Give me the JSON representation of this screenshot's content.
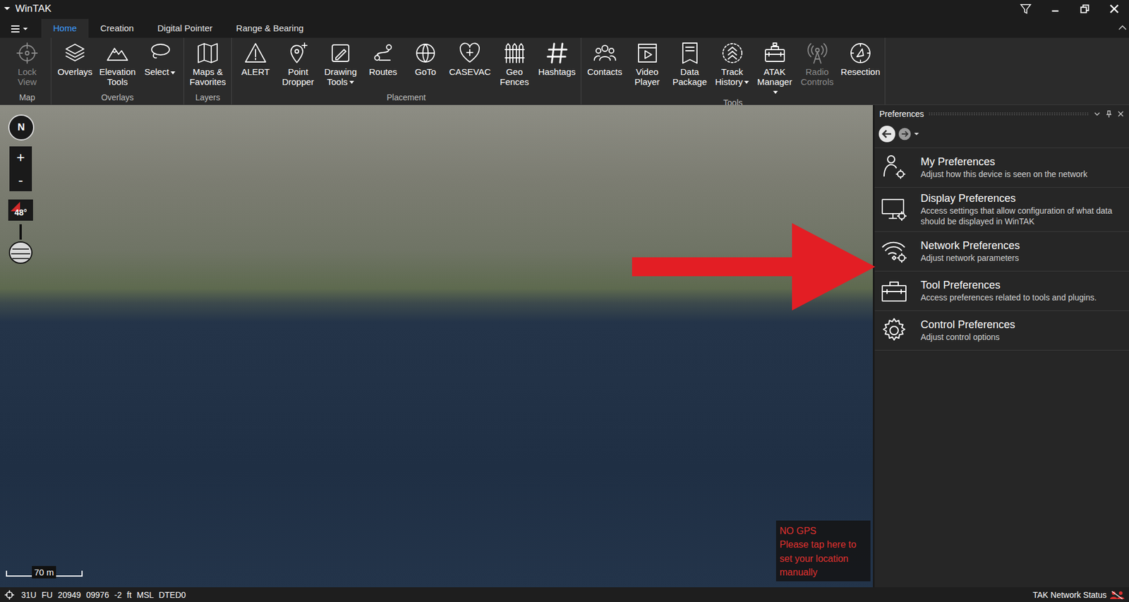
{
  "window": {
    "title": "WinTAK"
  },
  "tabs": [
    {
      "label": "Home",
      "selected": true
    },
    {
      "label": "Creation",
      "selected": false
    },
    {
      "label": "Digital Pointer",
      "selected": false
    },
    {
      "label": "Range & Bearing",
      "selected": false
    }
  ],
  "ribbon_groups": [
    {
      "label": "Map",
      "buttons": [
        {
          "label": "Lock View",
          "disabled": true,
          "dropdown": false
        }
      ]
    },
    {
      "label": "Overlays",
      "buttons": [
        {
          "label": "Overlays",
          "disabled": false,
          "dropdown": false
        },
        {
          "label": "Elevation Tools",
          "disabled": false,
          "dropdown": false
        },
        {
          "label": "Select",
          "disabled": false,
          "dropdown": true
        }
      ]
    },
    {
      "label": "Layers",
      "buttons": [
        {
          "label": "Maps & Favorites",
          "disabled": false,
          "dropdown": false
        }
      ]
    },
    {
      "label": "Placement",
      "buttons": [
        {
          "label": "ALERT",
          "disabled": false,
          "dropdown": false
        },
        {
          "label": "Point Dropper",
          "disabled": false,
          "dropdown": false
        },
        {
          "label": "Drawing Tools",
          "disabled": false,
          "dropdown": true
        },
        {
          "label": "Routes",
          "disabled": false,
          "dropdown": false
        },
        {
          "label": "GoTo",
          "disabled": false,
          "dropdown": false
        },
        {
          "label": "CASEVAC",
          "disabled": false,
          "dropdown": false
        },
        {
          "label": "Geo Fences",
          "disabled": false,
          "dropdown": false
        },
        {
          "label": "Hashtags",
          "disabled": false,
          "dropdown": false
        }
      ]
    },
    {
      "label": "Tools",
      "buttons": [
        {
          "label": "Contacts",
          "disabled": false,
          "dropdown": false
        },
        {
          "label": "Video Player",
          "disabled": false,
          "dropdown": false
        },
        {
          "label": "Data Package",
          "disabled": false,
          "dropdown": false
        },
        {
          "label": "Track History",
          "disabled": false,
          "dropdown": true
        },
        {
          "label": "ATAK Manager",
          "disabled": false,
          "dropdown": true
        },
        {
          "label": "Radio Controls",
          "disabled": true,
          "dropdown": false
        },
        {
          "label": "Resection",
          "disabled": false,
          "dropdown": false
        }
      ]
    }
  ],
  "map": {
    "compass": "N",
    "zoom_in": "+",
    "zoom_out": "-",
    "tilt": "48°",
    "scale": "70 m",
    "gps_warning": {
      "title": "NO GPS",
      "lines": [
        "Please tap here to",
        "set your location",
        "manually"
      ]
    }
  },
  "preferences": {
    "title": "Preferences",
    "items": [
      {
        "title": "My Preferences",
        "description": "Adjust how this device is seen on the network"
      },
      {
        "title": "Display Preferences",
        "description": "Access settings that allow configuration of what data should be displayed in WinTAK"
      },
      {
        "title": "Network Preferences",
        "description": "Adjust network parameters"
      },
      {
        "title": "Tool Preferences",
        "description": "Access preferences related to tools and plugins."
      },
      {
        "title": "Control Preferences",
        "description": "Adjust control options"
      }
    ]
  },
  "status_bar": {
    "coordinates": "31U FU 20949 09976 -2 ft MSL DTED0",
    "network_status": "TAK Network Status"
  }
}
